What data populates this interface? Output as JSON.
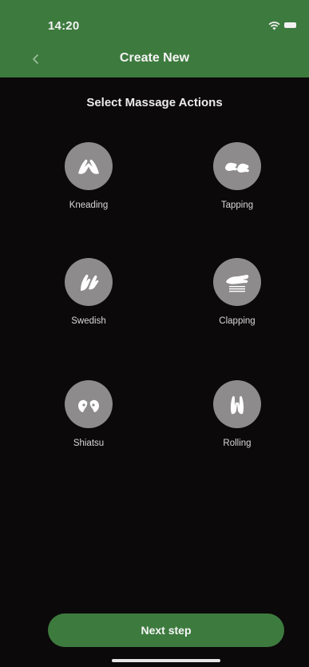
{
  "status_bar": {
    "time": "14:20",
    "wifi_icon": "wifi-icon",
    "battery_icon": "battery-icon"
  },
  "nav": {
    "back_icon": "chevron-left-icon",
    "title": "Create New"
  },
  "section_title": "Select Massage Actions",
  "actions": [
    {
      "label": "Kneading",
      "icon": "kneading-hands-icon"
    },
    {
      "label": "Tapping",
      "icon": "tapping-hands-icon"
    },
    {
      "label": "Swedish",
      "icon": "swedish-hands-icon"
    },
    {
      "label": "Clapping",
      "icon": "clapping-hand-icon"
    },
    {
      "label": "Shiatsu",
      "icon": "shiatsu-hands-icon"
    },
    {
      "label": "Rolling",
      "icon": "rolling-hands-icon"
    }
  ],
  "next_button": {
    "label": "Next step"
  },
  "colors": {
    "header_green": "#3d7a3e",
    "button_green": "#3d7a3e",
    "background": "#0b0909",
    "icon_circle": "#8d8b8b"
  }
}
